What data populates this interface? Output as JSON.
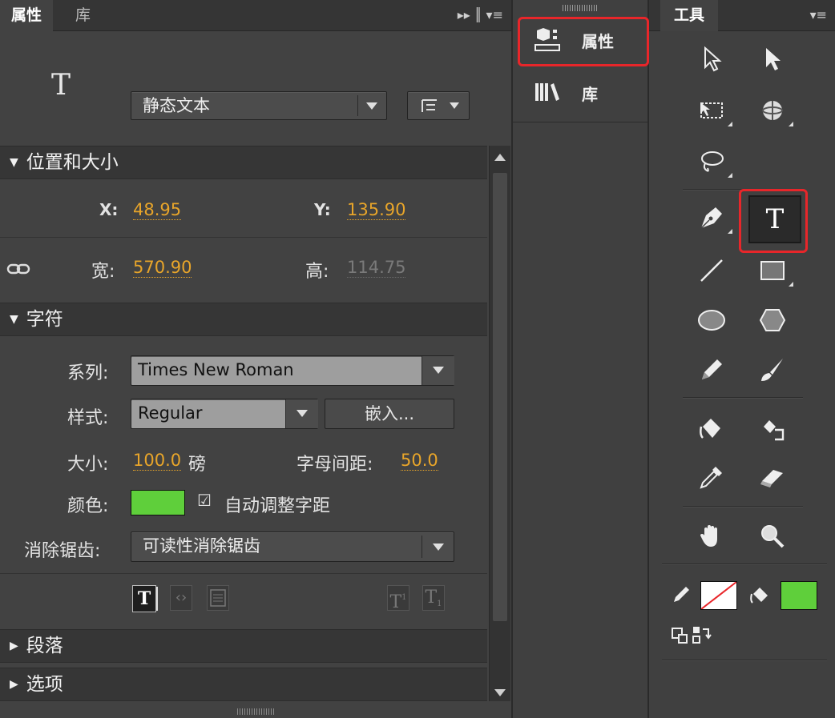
{
  "props_panel": {
    "tabs": [
      {
        "label": "属性"
      },
      {
        "label": "库"
      }
    ],
    "header_menu": "▸▸ ║ ▾≡",
    "text_type": "静态文本",
    "big_t": "T",
    "sections": {
      "position": "位置和大小",
      "character": "字符",
      "paragraph": "段落",
      "options": "选项"
    },
    "position": {
      "x_label": "X:",
      "x_value": "48.95",
      "y_label": "Y:",
      "y_value": "135.90",
      "w_label": "宽:",
      "w_value": "570.90",
      "h_label": "高:",
      "h_value": "114.75"
    },
    "character": {
      "family_label": "系列:",
      "family_value": "Times New Roman",
      "style_label": "样式:",
      "style_value": "Regular",
      "embed_label": "嵌入...",
      "size_label": "大小:",
      "size_value": "100.0",
      "size_unit": "磅",
      "spacing_label": "字母间距:",
      "spacing_value": "50.0",
      "color_label": "颜色:",
      "color_value": "#5fcf3b",
      "kerning_label": "自动调整字距",
      "kerning_checked": "☑",
      "antialias_label": "消除锯齿:",
      "antialias_value": "可读性消除锯齿"
    }
  },
  "dock": {
    "items": [
      {
        "label": "属性"
      },
      {
        "label": "库"
      }
    ]
  },
  "tools_panel": {
    "title": "工具",
    "menu_icon": "▾≡",
    "stroke_color": "none",
    "fill_color": "#5fcf3b"
  },
  "colors": {
    "accent_value": "#e8a52a",
    "highlight": "#e8262a",
    "green": "#5fcf3b"
  }
}
